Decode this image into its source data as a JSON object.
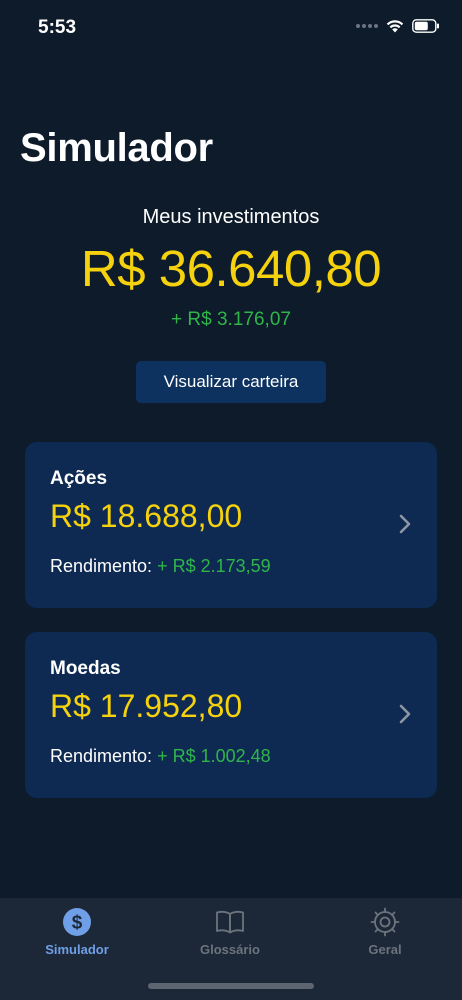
{
  "status_bar": {
    "time": "5:53"
  },
  "header": {
    "title": "Simulador"
  },
  "summary": {
    "label": "Meus investimentos",
    "total": "R$ 36.640,80",
    "gain": "+ R$ 3.176,07",
    "wallet_button_label": "Visualizar carteira"
  },
  "cards": [
    {
      "title": "Ações",
      "value": "R$ 18.688,00",
      "yield_label": "Rendimento:",
      "yield_value": "+ R$ 2.173,59"
    },
    {
      "title": "Moedas",
      "value": "R$ 17.952,80",
      "yield_label": "Rendimento:",
      "yield_value": "+ R$ 1.002,48"
    }
  ],
  "tab_bar": {
    "tabs": [
      {
        "label": "Simulador",
        "icon": "dollar-circle-icon",
        "active": true
      },
      {
        "label": "Glossário",
        "icon": "book-icon",
        "active": false
      },
      {
        "label": "Geral",
        "icon": "gear-icon",
        "active": false
      }
    ]
  },
  "colors": {
    "background": "#0d1b2a",
    "card": "#0e2a52",
    "accent_yellow": "#f5d20d",
    "gain_green": "#2fb54a",
    "tab_active": "#6f9fe6"
  }
}
